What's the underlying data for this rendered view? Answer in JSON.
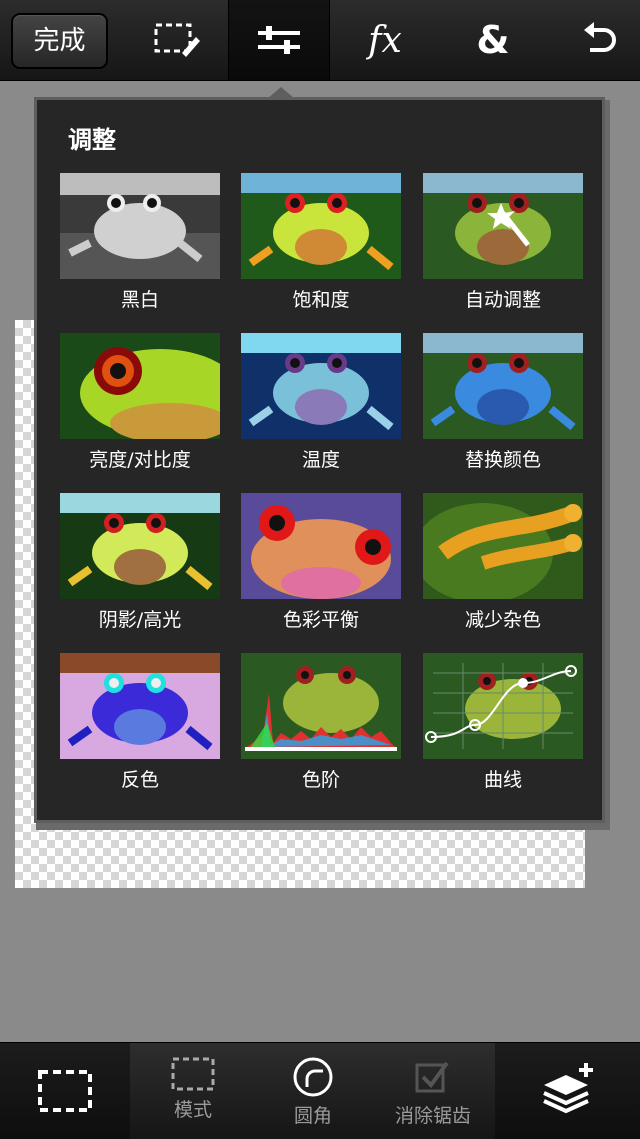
{
  "toolbar": {
    "done_label": "完成",
    "tools": [
      {
        "name": "selection-edit-icon"
      },
      {
        "name": "adjustments-icon",
        "active": true
      },
      {
        "name": "fx-icon",
        "text": "fx"
      },
      {
        "name": "ampersand-icon",
        "text": "&"
      },
      {
        "name": "undo-icon"
      }
    ]
  },
  "panel": {
    "title": "调整",
    "items": [
      {
        "label": "黑白"
      },
      {
        "label": "饱和度"
      },
      {
        "label": "自动调整"
      },
      {
        "label": "亮度/对比度"
      },
      {
        "label": "温度"
      },
      {
        "label": "替换颜色"
      },
      {
        "label": "阴影/高光"
      },
      {
        "label": "色彩平衡"
      },
      {
        "label": "减少杂色"
      },
      {
        "label": "反色"
      },
      {
        "label": "色阶"
      },
      {
        "label": "曲线"
      }
    ]
  },
  "bottom": {
    "mode_label": "模式",
    "round_label": "圆角",
    "antialias_label": "消除锯齿"
  }
}
